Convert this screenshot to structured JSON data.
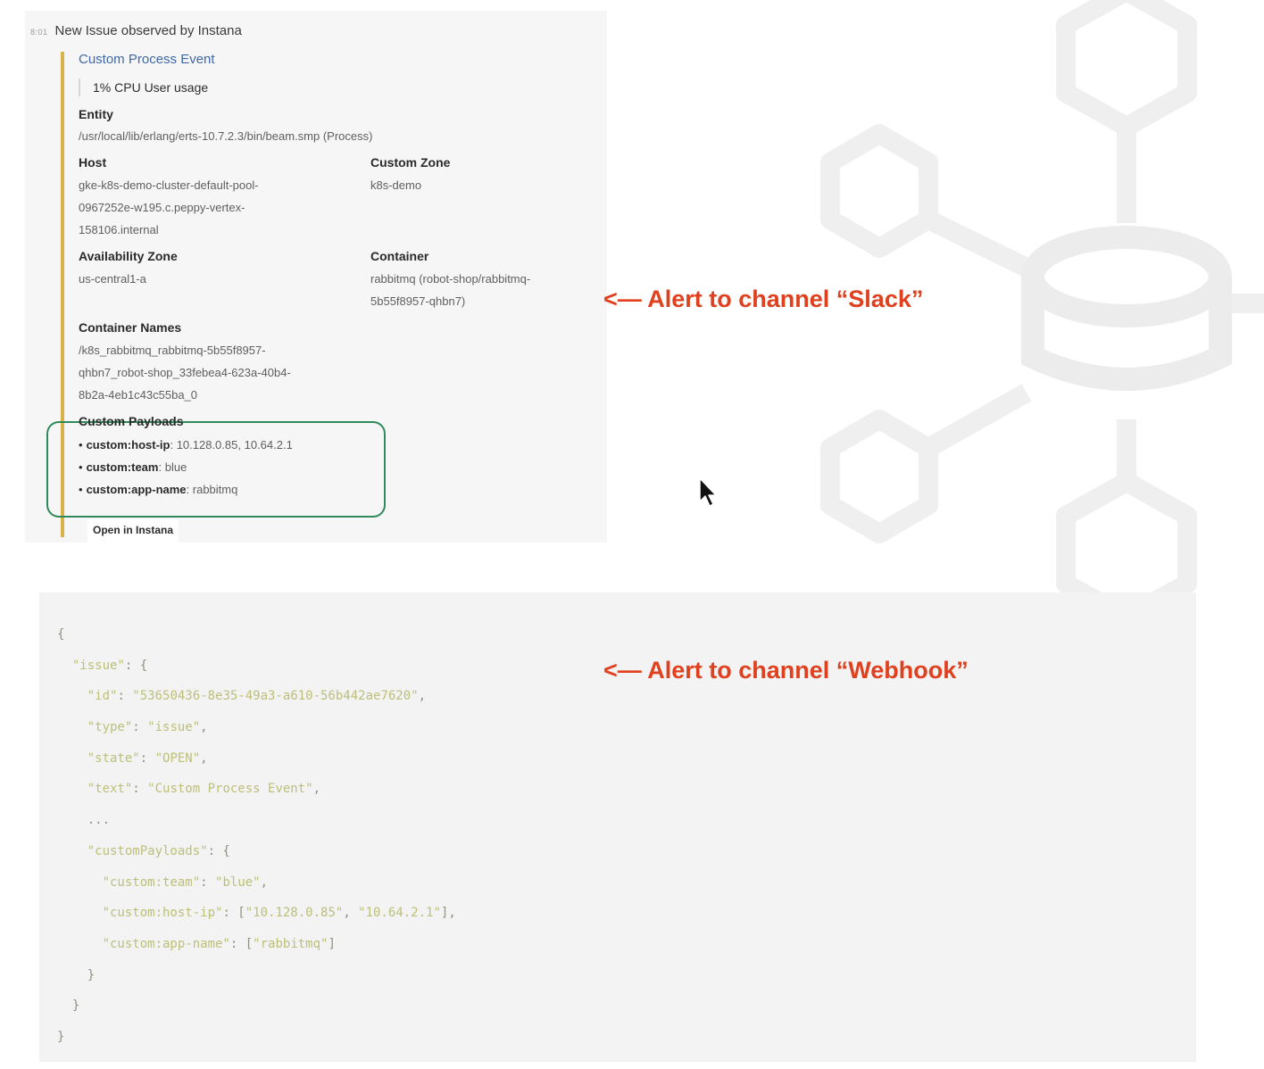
{
  "slack": {
    "timestamp": "8:01",
    "header": "New Issue observed by Instana",
    "event_link": "Custom Process Event",
    "quote": "1%  CPU User usage",
    "entity": {
      "label": "Entity",
      "value": "/usr/local/lib/erlang/erts-10.7.2.3/bin/beam.smp (Process)"
    },
    "host": {
      "label": "Host",
      "value_lines": [
        "gke-k8s-demo-cluster-default-pool-",
        "0967252e-w195.c.peppy-vertex-",
        "158106.internal"
      ]
    },
    "custom_zone": {
      "label": "Custom Zone",
      "value": "k8s-demo"
    },
    "availability_zone": {
      "label": "Availability Zone",
      "value": "us-central1-a"
    },
    "container": {
      "label": "Container",
      "value_lines": [
        "rabbitmq (robot-shop/rabbitmq-",
        "5b55f8957-qhbn7)"
      ]
    },
    "container_names": {
      "label": "Container Names",
      "value_lines": [
        "/k8s_rabbitmq_rabbitmq-5b55f8957-",
        "qhbn7_robot-shop_33febea4-623a-40b4-",
        "8b2a-4eb1c43c55ba_0"
      ]
    },
    "custom_payloads": {
      "label": "Custom Payloads",
      "items": [
        {
          "key": "custom:host-ip",
          "value": "10.128.0.85, 10.64.2.1"
        },
        {
          "key": "custom:team",
          "value": "blue"
        },
        {
          "key": "custom:app-name",
          "value": "rabbitmq"
        }
      ]
    },
    "open_button": "Open in Instana"
  },
  "annotations": {
    "slack": "<— Alert to channel “Slack”",
    "webhook": "<— Alert to channel “Webhook”"
  },
  "json_lines": [
    "{",
    "  \"issue\": {",
    "    \"id\": \"53650436-8e35-49a3-a610-56b442ae7620\",",
    "    \"type\": \"issue\",",
    "    \"state\": \"OPEN\",",
    "    \"text\": \"Custom Process Event\",",
    "    ...",
    "    \"customPayloads\": {",
    "      \"custom:team\": \"blue\",",
    "      \"custom:host-ip\": [\"10.128.0.85\", \"10.64.2.1\"],",
    "      \"custom:app-name\": [\"rabbitmq\"]",
    "    }",
    "  }",
    "}"
  ],
  "colors": {
    "annotation": "#e0401e",
    "attachment_bar": "#d8b34a",
    "payload_highlight": "#2e8a5a",
    "link": "#3f68a8"
  }
}
